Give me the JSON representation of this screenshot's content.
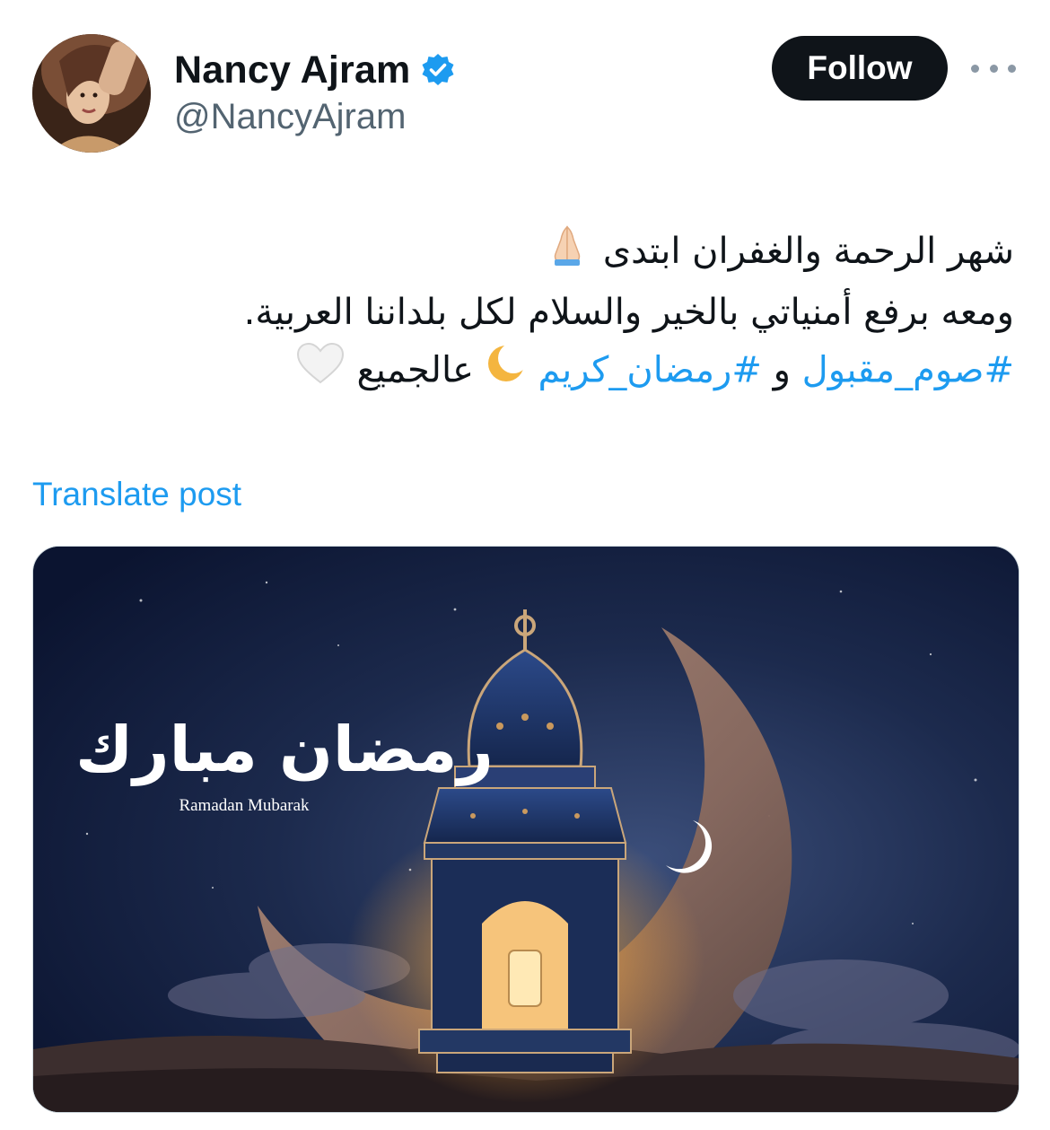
{
  "author": {
    "display_name": "Nancy Ajram",
    "handle": "@NancyAjram",
    "verified": true,
    "verified_color": "#1d9bf0"
  },
  "actions": {
    "follow_label": "Follow",
    "more_icon": "more-horizontal-icon"
  },
  "tweet": {
    "line1_text": "شهر الرحمة والغفران ابتدى",
    "line1_emoji": "folded-hands-emoji",
    "line2_text": "ومعه برفع أمنياتي بالخير والسلام لكل بلداننا العربية.",
    "line3": {
      "hashtag1": "#صوم_مقبول",
      "connector": "و",
      "hashtag2": "#رمضان_كريم",
      "crescent_emoji": "crescent-moon-emoji",
      "tail_text": "عالجميع",
      "heart_emoji": "white-heart-emoji"
    },
    "hashtag_color": "#1d9bf0"
  },
  "translate_label": "Translate post",
  "media": {
    "calligraphy": "رمضان مبارك",
    "caption": "Ramadan Mubarak",
    "icon": "ramadan-lantern-image"
  }
}
